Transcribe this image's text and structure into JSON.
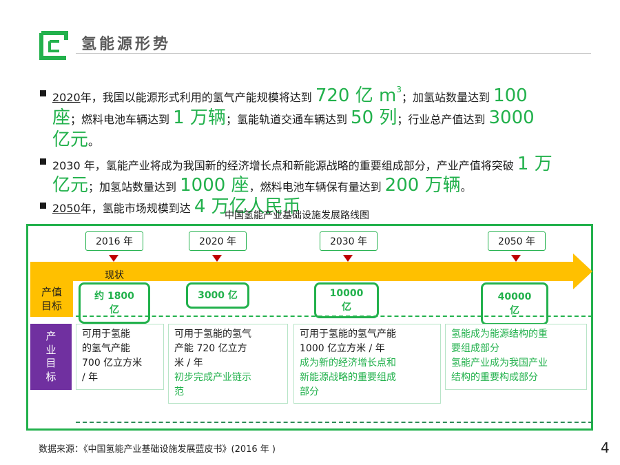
{
  "header": {
    "title": "氢能源形势"
  },
  "bullets": {
    "b1": {
      "year": "2020",
      "t1": "年，我国以能源形式利用的氢气产能规模将达到",
      "v1": "720 亿 m",
      "v1_sup": "3",
      "t2": "；加氢站数量达到",
      "v2": "100",
      "v2b": "座",
      "t3": "；燃料电池车辆达到",
      "v3": "1 万辆",
      "t4": "；氢能轨道交通车辆达到",
      "v4": "50 列",
      "t5": "；行业总产值达到",
      "v5": "3000",
      "v5b": "亿元",
      "t6": "。"
    },
    "b2": {
      "t1": "2030 年，氢能产业将成为我国新的经济增长点和新能源战略的重要组成部分，产业产值将突破",
      "v1": "1 万",
      "v1b": "亿元",
      "t2": "；加氢站数量达到",
      "v2": "1000 座",
      "t3": "，燃料电池车辆保有量达到",
      "v3": "200 万辆",
      "t4": "。"
    },
    "b3": {
      "year": "2050",
      "t1": "年，氢能市场规模到达",
      "v1": "4 万亿人民币"
    }
  },
  "roadmap": {
    "title": "中国氢能产业基础设施发展路线图",
    "years": [
      "2016 年",
      "2020 年",
      "2030 年",
      "2050 年"
    ],
    "current_label": "现状",
    "row_value_label": [
      "产值",
      "目标"
    ],
    "row_capacity_label": [
      "产",
      "业",
      "目",
      "标"
    ],
    "values": [
      [
        "约 1800",
        "亿"
      ],
      [
        "3000 亿"
      ],
      [
        "10000",
        "亿"
      ],
      [
        "40000",
        "亿"
      ]
    ],
    "cells": [
      {
        "black": [
          "可用于氢能",
          "的氢气产能",
          "700 亿立方米",
          "/ 年"
        ],
        "green": []
      },
      {
        "black": [
          "可用于氢能的氢气",
          "产能 720 亿立方",
          "米 / 年"
        ],
        "green": [
          "初步完成产业链示",
          "范"
        ]
      },
      {
        "black": [
          "可用于氢能的氢气产能",
          "1000 亿立方米 / 年"
        ],
        "green": [
          "成为新的经济增长点和",
          "新能源战略的重要组成",
          "部分"
        ]
      },
      {
        "black": [],
        "green": [
          "氢能成为能源结构的重",
          "要组成部分",
          "氢能产业成为我国产业",
          "结构的重要构成部分"
        ]
      }
    ]
  },
  "footer": {
    "source": "数据来源：《中国氢能产业基础设施发展蓝皮书》(2016 年 )",
    "page": "4"
  },
  "colors": {
    "accent": "#22b14c",
    "arrow": "#ffc000",
    "purple": "#7030a0",
    "marker": "#c00000"
  }
}
